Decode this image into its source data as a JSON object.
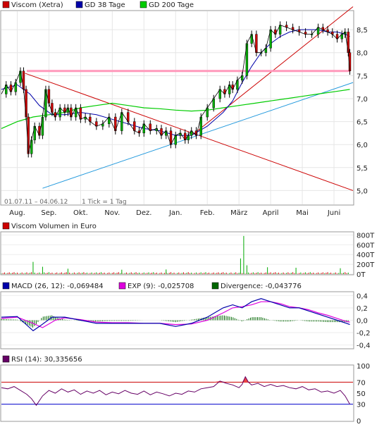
{
  "chart_data": [
    {
      "type": "line",
      "title": "",
      "legend": [
        {
          "label": "Viscom (Xetra)",
          "color": "#cc0000"
        },
        {
          "label": "GD 38 Tage",
          "color": "#0000aa"
        },
        {
          "label": "GD 200 Tage",
          "color": "#00cc00"
        }
      ],
      "date_range": "01.07.11 – 04.06.12",
      "tick_note": "1 Tick = 1 Tag",
      "x_labels": [
        "Aug.",
        "Sep.",
        "Okt.",
        "Nov.",
        "Dez.",
        "Jan.",
        "Feb.",
        "März",
        "April",
        "Mai",
        "Juni"
      ],
      "x_positions": [
        0.5,
        1.5,
        2.5,
        3.5,
        4.5,
        5.5,
        6.5,
        7.5,
        8.5,
        9.5,
        10.5
      ],
      "xlim": [
        0,
        11.1
      ],
      "y_ticks": [
        5.0,
        5.5,
        6.0,
        6.5,
        7.0,
        7.5,
        8.0,
        8.5
      ],
      "y_tick_labels": [
        "5,0",
        "5,5",
        "6,0",
        "6,5",
        "7,0",
        "7,5",
        "8,0",
        "8,5"
      ],
      "ylim": [
        4.7,
        8.9
      ],
      "price": {
        "x": [
          0.0,
          0.15,
          0.3,
          0.45,
          0.6,
          0.7,
          0.78,
          0.85,
          0.95,
          1.05,
          1.2,
          1.3,
          1.4,
          1.5,
          1.6,
          1.7,
          1.85,
          2.0,
          2.1,
          2.2,
          2.35,
          2.5,
          2.65,
          2.8,
          3.0,
          3.2,
          3.4,
          3.6,
          3.8,
          4.0,
          4.2,
          4.35,
          4.5,
          4.7,
          4.9,
          5.05,
          5.2,
          5.35,
          5.5,
          5.65,
          5.8,
          5.9,
          6.0,
          6.15,
          6.3,
          6.5,
          6.7,
          6.9,
          7.05,
          7.2,
          7.3,
          7.45,
          7.6,
          7.75,
          7.9,
          8.05,
          8.2,
          8.35,
          8.5,
          8.65,
          8.8,
          9.0,
          9.2,
          9.4,
          9.6,
          9.8,
          10.0,
          10.15,
          10.3,
          10.45,
          10.6,
          10.75,
          10.85,
          10.95,
          11.0
        ],
        "values": [
          7.1,
          7.3,
          7.15,
          7.35,
          7.6,
          7.2,
          6.6,
          5.8,
          6.1,
          6.4,
          6.2,
          6.6,
          7.2,
          6.9,
          6.7,
          6.6,
          6.8,
          6.7,
          6.8,
          6.6,
          6.8,
          6.55,
          6.6,
          6.5,
          6.4,
          6.45,
          6.6,
          6.3,
          6.7,
          6.5,
          6.3,
          6.25,
          6.45,
          6.3,
          6.35,
          6.2,
          6.3,
          6.0,
          6.2,
          6.25,
          6.1,
          6.2,
          6.3,
          6.2,
          6.6,
          6.8,
          7.0,
          7.2,
          7.1,
          7.3,
          7.2,
          7.4,
          7.5,
          8.2,
          8.4,
          8.0,
          8.0,
          8.1,
          8.5,
          8.4,
          8.6,
          8.55,
          8.5,
          8.45,
          8.4,
          8.4,
          8.55,
          8.5,
          8.45,
          8.4,
          8.3,
          8.4,
          8.45,
          8.0,
          7.6
        ]
      },
      "gd38": {
        "x": [
          0.0,
          0.5,
          0.9,
          1.2,
          1.6,
          2.0,
          2.5,
          3.0,
          3.5,
          4.0,
          4.5,
          5.0,
          5.5,
          6.0,
          6.5,
          7.0,
          7.3,
          7.6,
          7.9,
          8.2,
          8.5,
          8.8,
          9.1,
          9.4,
          9.7,
          10.0,
          10.3,
          10.6,
          10.85,
          11.0
        ],
        "values": [
          7.2,
          7.3,
          7.1,
          6.85,
          6.65,
          6.65,
          6.7,
          6.65,
          6.55,
          6.45,
          6.35,
          6.3,
          6.2,
          6.2,
          6.4,
          6.7,
          6.95,
          7.35,
          7.7,
          8.0,
          8.2,
          8.35,
          8.45,
          8.5,
          8.5,
          8.5,
          8.45,
          8.45,
          8.4,
          8.35
        ]
      },
      "gd200": {
        "x": [
          0.0,
          0.5,
          1.0,
          1.5,
          2.0,
          2.5,
          3.0,
          3.5,
          4.0,
          4.5,
          5.0,
          5.5,
          6.0,
          6.5,
          7.0,
          7.5,
          8.0,
          8.5,
          9.0,
          9.5,
          10.0,
          10.5,
          11.0
        ],
        "values": [
          6.35,
          6.5,
          6.6,
          6.65,
          6.7,
          6.8,
          6.85,
          6.9,
          6.85,
          6.8,
          6.78,
          6.75,
          6.73,
          6.75,
          6.8,
          6.85,
          6.9,
          6.95,
          7.0,
          7.05,
          7.1,
          7.15,
          7.2
        ]
      },
      "trendlines": [
        {
          "color": "#cc0000",
          "points": [
            [
              0.75,
              7.55
            ],
            [
              11.1,
              5.0
            ]
          ]
        },
        {
          "color": "#cc0000",
          "points": [
            [
              6.1,
              6.25
            ],
            [
              11.1,
              9.0
            ]
          ]
        },
        {
          "color": "#2299dd",
          "points": [
            [
              1.3,
              5.05
            ],
            [
              11.1,
              7.35
            ]
          ]
        }
      ],
      "hline": {
        "color": "#ff99bb",
        "value": 7.6
      }
    },
    {
      "type": "bar",
      "legend": [
        {
          "label": "Viscom Volumen in Euro",
          "color": "#cc0000"
        }
      ],
      "y_tick_labels": [
        "800T",
        "600T",
        "400T",
        "200T",
        "0T"
      ],
      "y_ticks": [
        800,
        600,
        400,
        200,
        0
      ],
      "ylim": [
        0,
        850
      ],
      "spikes": [
        {
          "x": 1.0,
          "value": 250
        },
        {
          "x": 1.3,
          "value": 150
        },
        {
          "x": 2.1,
          "value": 110
        },
        {
          "x": 3.8,
          "value": 90
        },
        {
          "x": 5.2,
          "value": 95
        },
        {
          "x": 7.55,
          "value": 320
        },
        {
          "x": 7.65,
          "value": 780
        },
        {
          "x": 7.75,
          "value": 180
        },
        {
          "x": 8.4,
          "value": 140
        },
        {
          "x": 9.3,
          "value": 130
        },
        {
          "x": 10.7,
          "value": 120
        }
      ],
      "base_level": 30
    },
    {
      "type": "line",
      "legend": [
        {
          "label": "MACD (26, 12): -0,069484",
          "color": "#0000aa"
        },
        {
          "label": "EXP (9): -0,025708",
          "color": "#dd00dd"
        },
        {
          "label": "Divergence: -0,043776",
          "color": "#006600"
        }
      ],
      "y_ticks": [
        0.4,
        0.2,
        0.0,
        -0.2,
        -0.4
      ],
      "y_tick_labels": [
        "0,4",
        "0,2",
        "0,0",
        "-0,2",
        "-0,4"
      ],
      "ylim": [
        -0.45,
        0.45
      ],
      "macd": {
        "x": [
          0.0,
          0.5,
          1.0,
          1.2,
          1.6,
          2.0,
          2.5,
          3.0,
          3.5,
          4.0,
          4.5,
          5.0,
          5.5,
          6.0,
          6.5,
          7.0,
          7.3,
          7.6,
          7.9,
          8.2,
          8.5,
          8.8,
          9.1,
          9.4,
          9.7,
          10.0,
          10.3,
          10.6,
          10.9,
          11.0
        ],
        "values": [
          0.05,
          0.06,
          -0.17,
          -0.1,
          0.05,
          0.05,
          0.0,
          -0.05,
          -0.05,
          -0.05,
          -0.05,
          -0.05,
          -0.1,
          -0.05,
          0.05,
          0.2,
          0.25,
          0.2,
          0.3,
          0.35,
          0.3,
          0.25,
          0.2,
          0.2,
          0.15,
          0.1,
          0.05,
          0.0,
          -0.05,
          -0.07
        ]
      },
      "exp": {
        "x": [
          0.0,
          0.5,
          1.0,
          1.3,
          1.7,
          2.0,
          2.5,
          3.0,
          3.5,
          4.0,
          4.5,
          5.0,
          5.5,
          6.0,
          6.5,
          7.0,
          7.3,
          7.6,
          7.9,
          8.2,
          8.5,
          8.8,
          9.1,
          9.4,
          9.7,
          10.0,
          10.3,
          10.6,
          10.9,
          11.0
        ],
        "values": [
          0.03,
          0.05,
          -0.05,
          -0.12,
          0.0,
          0.04,
          0.01,
          -0.03,
          -0.04,
          -0.04,
          -0.05,
          -0.05,
          -0.07,
          -0.06,
          0.0,
          0.12,
          0.2,
          0.22,
          0.25,
          0.3,
          0.3,
          0.27,
          0.22,
          0.2,
          0.17,
          0.12,
          0.08,
          0.03,
          -0.02,
          -0.03
        ]
      },
      "divergence_note": "histogram bars = MACD − EXP"
    },
    {
      "type": "line",
      "legend": [
        {
          "label": "RSI (14): 30,335656",
          "color": "#660066"
        }
      ],
      "y_ticks": [
        100,
        70,
        50,
        30,
        0
      ],
      "y_tick_labels": [
        "100",
        "70",
        "50",
        "30",
        "0"
      ],
      "ylim": [
        0,
        100
      ],
      "bands": [
        {
          "value": 70,
          "color": "#cc0000"
        },
        {
          "value": 30,
          "color": "#0000cc"
        }
      ],
      "rsi": {
        "x": [
          0.0,
          0.2,
          0.4,
          0.6,
          0.8,
          0.95,
          1.1,
          1.3,
          1.5,
          1.7,
          1.9,
          2.1,
          2.3,
          2.5,
          2.7,
          2.9,
          3.1,
          3.3,
          3.5,
          3.7,
          3.9,
          4.1,
          4.3,
          4.5,
          4.7,
          4.9,
          5.1,
          5.3,
          5.5,
          5.7,
          5.9,
          6.1,
          6.3,
          6.5,
          6.7,
          6.9,
          7.1,
          7.3,
          7.5,
          7.6,
          7.7,
          7.8,
          7.9,
          8.1,
          8.3,
          8.5,
          8.7,
          8.9,
          9.1,
          9.3,
          9.5,
          9.7,
          9.9,
          10.1,
          10.3,
          10.5,
          10.7,
          10.85,
          11.0
        ],
        "values": [
          60,
          58,
          62,
          55,
          48,
          40,
          28,
          45,
          55,
          50,
          58,
          52,
          56,
          48,
          54,
          50,
          55,
          47,
          52,
          49,
          55,
          50,
          48,
          54,
          47,
          52,
          49,
          45,
          50,
          48,
          54,
          52,
          58,
          60,
          62,
          72,
          68,
          65,
          60,
          66,
          80,
          70,
          65,
          68,
          62,
          66,
          62,
          64,
          60,
          58,
          62,
          56,
          58,
          52,
          54,
          50,
          55,
          45,
          30
        ]
      }
    }
  ]
}
